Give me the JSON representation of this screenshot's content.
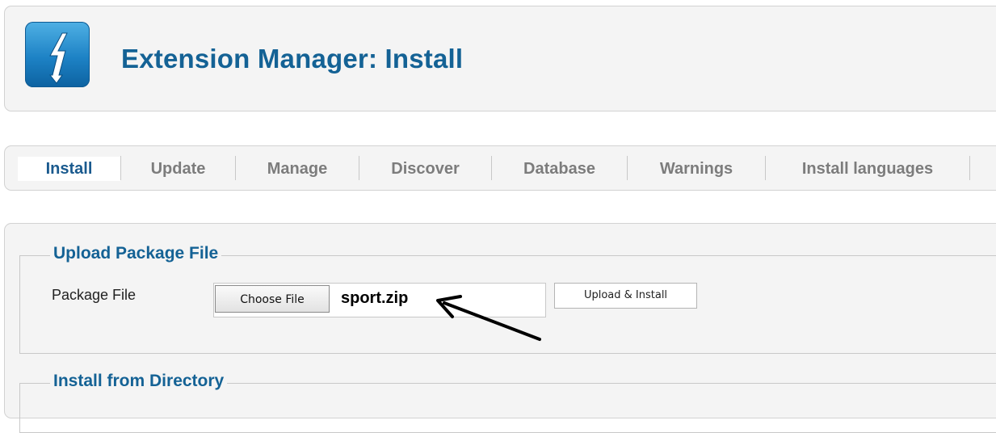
{
  "header": {
    "title": "Extension Manager: Install",
    "logo_icon": "lightning-bolt-icon",
    "logo_color": "#1d82c5"
  },
  "tabs": [
    {
      "label": "Install",
      "active": true
    },
    {
      "label": "Update",
      "active": false
    },
    {
      "label": "Manage",
      "active": false
    },
    {
      "label": "Discover",
      "active": false
    },
    {
      "label": "Database",
      "active": false
    },
    {
      "label": "Warnings",
      "active": false
    },
    {
      "label": "Install languages",
      "active": false
    }
  ],
  "upload": {
    "legend": "Upload Package File",
    "field_label": "Package File",
    "choose_button": "Choose File",
    "file_name": "sport.zip",
    "submit_button": "Upload & Install"
  },
  "directory": {
    "legend": "Install from Directory"
  },
  "colors": {
    "title": "#146295",
    "panel_bg": "#f4f4f4",
    "panel_border": "#d2d2d2"
  }
}
